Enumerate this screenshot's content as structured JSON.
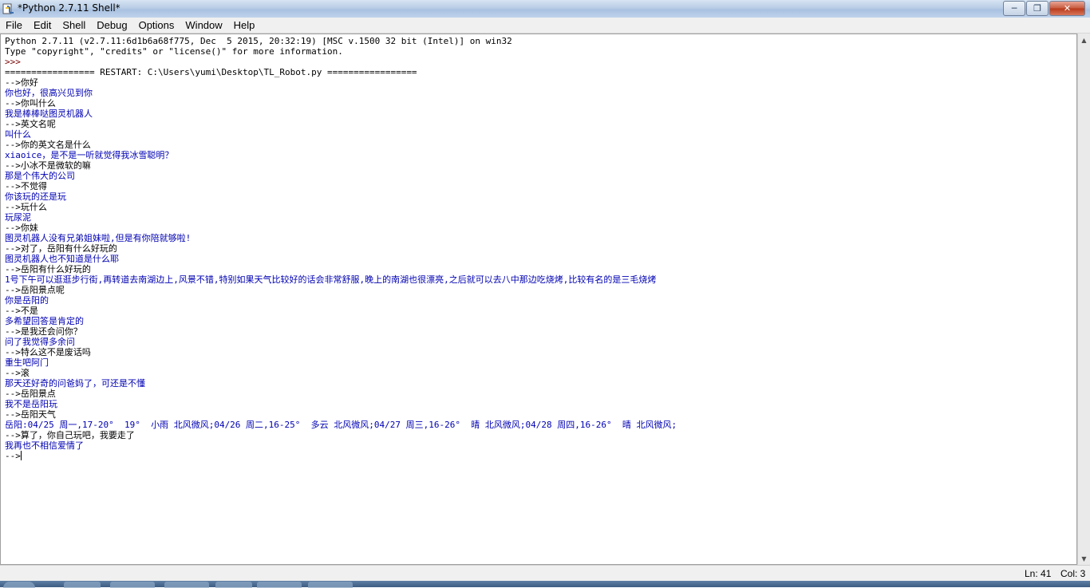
{
  "window": {
    "title": "*Python 2.7.11 Shell*",
    "icon": "python-idle-icon",
    "controls": [
      "minimize",
      "maximize",
      "close"
    ]
  },
  "menu": [
    "File",
    "Edit",
    "Shell",
    "Debug",
    "Options",
    "Window",
    "Help"
  ],
  "shell_lines": [
    {
      "text": "Python 2.7.11 (v2.7.11:6d1b6a68f775, Dec  5 2015, 20:32:19) [MSC v.1500 32 bit (Intel)] on win32",
      "kind": "std"
    },
    {
      "text": "Type \"copyright\", \"credits\" or \"license()\" for more information.",
      "kind": "std"
    },
    {
      "text": ">>> ",
      "kind": "prompt"
    },
    {
      "text": "================= RESTART: C:\\Users\\yumi\\Desktop\\TL_Robot.py =================",
      "kind": "std"
    },
    {
      "text": "-->你好",
      "kind": "std"
    },
    {
      "text": "你也好，很高兴见到你",
      "kind": "out"
    },
    {
      "text": "-->你叫什么",
      "kind": "std"
    },
    {
      "text": "我是棒棒哒图灵机器人",
      "kind": "out"
    },
    {
      "text": "-->英文名呢",
      "kind": "std"
    },
    {
      "text": "叫什么",
      "kind": "out"
    },
    {
      "text": "-->你的英文名是什么",
      "kind": "std"
    },
    {
      "text": "xiaoice，是不是一听就觉得我冰雪聪明？",
      "kind": "out"
    },
    {
      "text": "-->小冰不是微软的嘛",
      "kind": "std"
    },
    {
      "text": "那是个伟大的公司",
      "kind": "out"
    },
    {
      "text": "-->不觉得",
      "kind": "std"
    },
    {
      "text": "你该玩的还是玩",
      "kind": "out"
    },
    {
      "text": "-->玩什么",
      "kind": "std"
    },
    {
      "text": "玩尿泥",
      "kind": "out"
    },
    {
      "text": "-->你妹",
      "kind": "std"
    },
    {
      "text": "图灵机器人没有兄弟姐妹啦,但是有你陪就够啦!",
      "kind": "out"
    },
    {
      "text": "-->对了，岳阳有什么好玩的",
      "kind": "std"
    },
    {
      "text": "图灵机器人也不知道是什么耶",
      "kind": "out"
    },
    {
      "text": "-->岳阳有什么好玩的",
      "kind": "std"
    },
    {
      "text": "1号下午可以逛逛步行街,再转道去南湖边上,风景不错,特别如果天气比较好的话会非常舒服,晚上的南湖也很漂亮,之后就可以去八中那边吃烧烤,比较有名的是三毛烧烤",
      "kind": "out"
    },
    {
      "text": "-->岳阳景点呢",
      "kind": "std"
    },
    {
      "text": "你是岳阳的",
      "kind": "out"
    },
    {
      "text": "-->不是",
      "kind": "std"
    },
    {
      "text": "多希望回答是肯定的",
      "kind": "out"
    },
    {
      "text": "-->是我还会问你？",
      "kind": "std"
    },
    {
      "text": "问了我觉得多余问",
      "kind": "out"
    },
    {
      "text": "-->特么这不是废话吗",
      "kind": "std"
    },
    {
      "text": "重生吧阿门",
      "kind": "out"
    },
    {
      "text": "-->滚",
      "kind": "std"
    },
    {
      "text": "那天还好奇的问爸妈了，可还是不懂",
      "kind": "out"
    },
    {
      "text": "-->岳阳景点",
      "kind": "std"
    },
    {
      "text": "我不是岳阳玩",
      "kind": "out"
    },
    {
      "text": "-->岳阳天气",
      "kind": "std"
    },
    {
      "text": "岳阳:04/25 周一,17-20°  19°  小雨 北风微风;04/26 周二,16-25°  多云 北风微风;04/27 周三,16-26°  晴 北风微风;04/28 周四,16-26°  晴 北风微风;",
      "kind": "out"
    },
    {
      "text": "-->算了，你自己玩吧，我要走了",
      "kind": "std"
    },
    {
      "text": "我再也不相信爱情了",
      "kind": "out"
    },
    {
      "text": "-->",
      "kind": "std",
      "caret": true
    }
  ],
  "status": {
    "line": "Ln: 41",
    "column": "Col: 3"
  }
}
